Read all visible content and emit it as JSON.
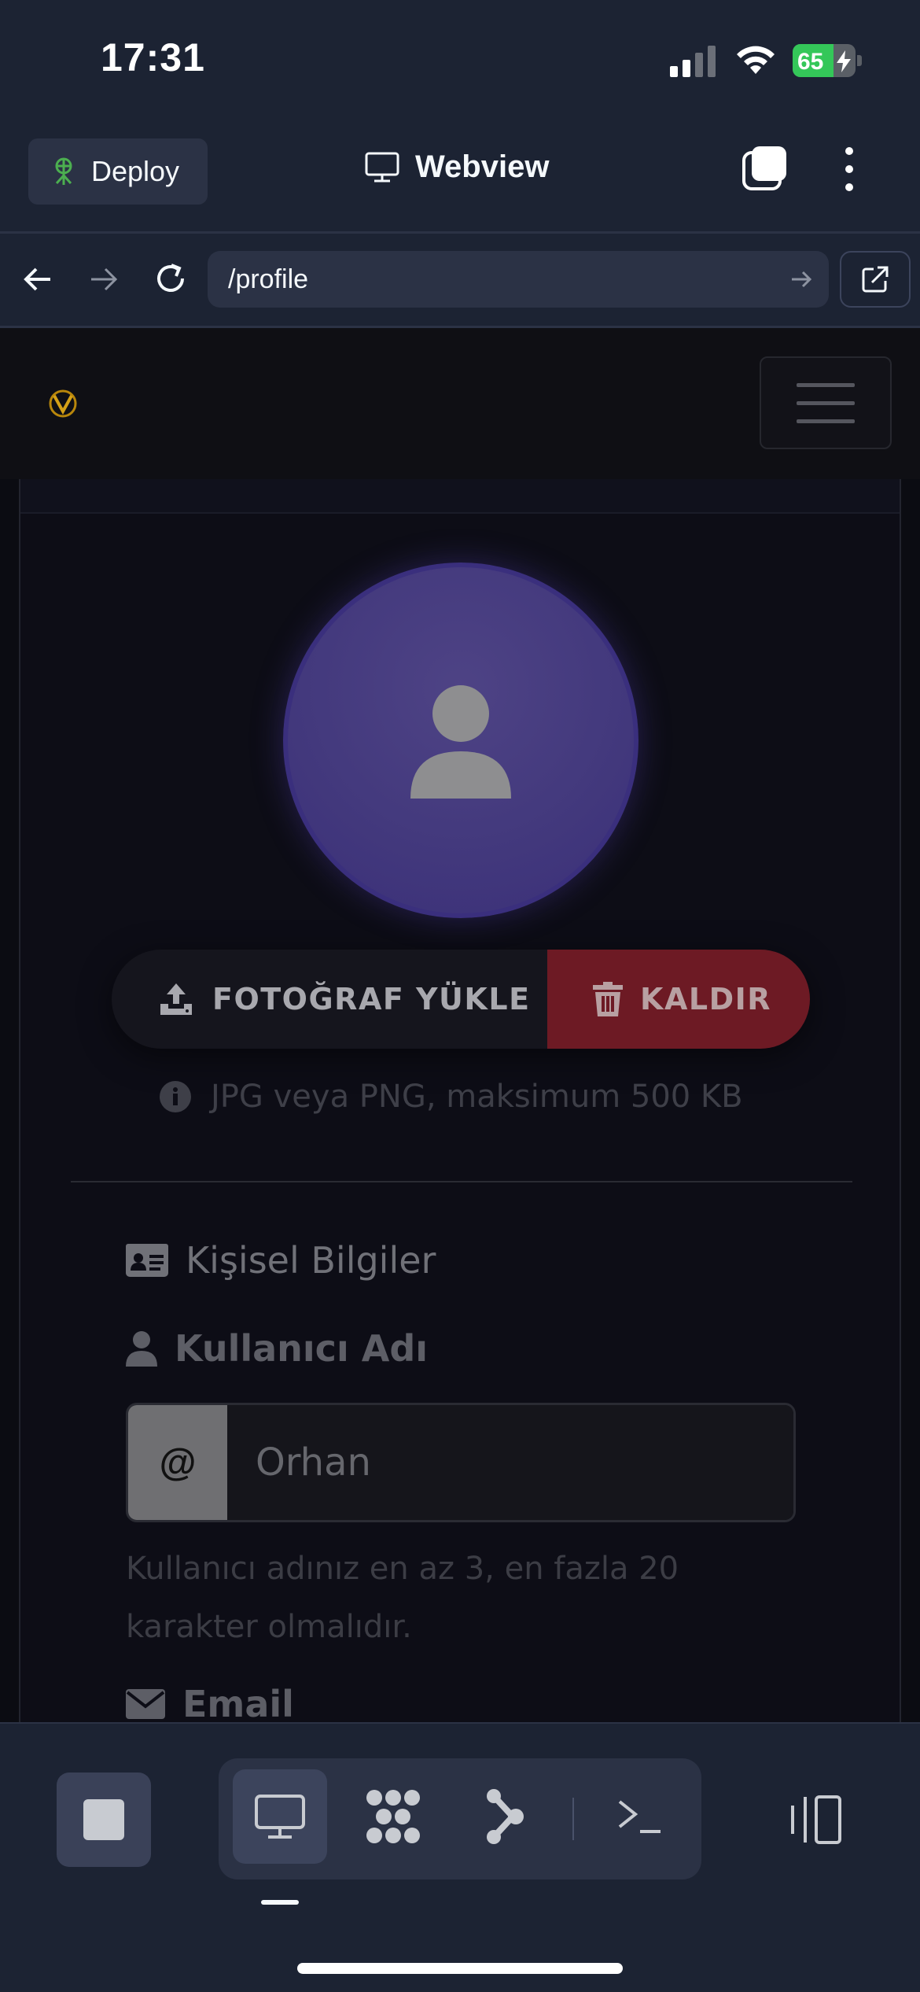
{
  "status_bar": {
    "time": "17:31",
    "battery_level": "65"
  },
  "app_header": {
    "deploy_label": "Deploy",
    "title": "Webview"
  },
  "url_bar": {
    "url": "/profile"
  },
  "page": {
    "upload_label": "FOTOĞRAF YÜKLE",
    "remove_label": "KALDIR",
    "hint": "JPG veya PNG, maksimum 500 KB",
    "section_title": "Kişisel Bilgiler",
    "username_label": "Kullanıcı Adı",
    "username_prefix": "@",
    "username_value": "Orhan",
    "username_help": "Kullanıcı adınız en az 3, en fazla 20 karakter olmalıdır.",
    "email_label": "Email"
  },
  "colors": {
    "app_bg": "#1c2333",
    "page_bg": "#0b0c12",
    "avatar": "#43397d",
    "remove_button": "#6d1a24",
    "battery": "#34c759"
  },
  "icons": [
    "deploy-icon",
    "monitor-icon",
    "tabs-icon",
    "more-vertical-icon",
    "back-arrow-icon",
    "forward-arrow-icon",
    "reload-icon",
    "external-link-icon",
    "logo-icon",
    "hamburger-icon",
    "user-silhouette-icon",
    "upload-icon",
    "trash-icon",
    "info-icon",
    "id-card-icon",
    "user-icon",
    "envelope-icon",
    "stop-icon",
    "webview-tool-icon",
    "packages-tool-icon",
    "git-tool-icon",
    "shell-tool-icon",
    "panel-toggle-icon"
  ]
}
